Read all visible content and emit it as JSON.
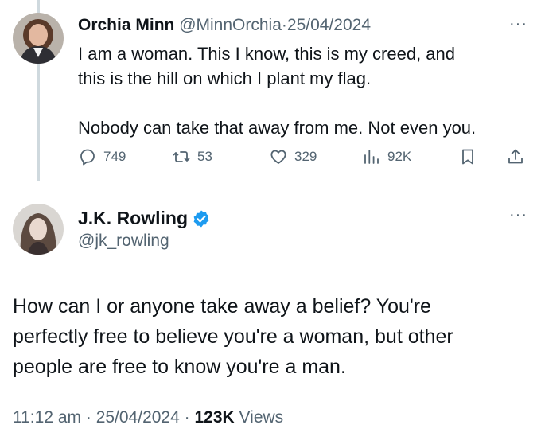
{
  "reply": {
    "author_name": "Orchia Minn",
    "handle": "@MinnOrchia",
    "separator": "·",
    "date": "25/04/2024",
    "more": "···",
    "text_lines": [
      "I am a woman.  This I know, this is my creed, and",
      "this is the hill on which I plant my flag.",
      "Nobody can take that away from me.  Not even you."
    ],
    "actions": {
      "replies": "749",
      "reposts": "53",
      "likes": "329",
      "views": "92K"
    }
  },
  "main": {
    "author_name": "J.K. Rowling",
    "handle": "@jk_rowling",
    "verified": true,
    "more": "···",
    "text_lines": [
      "How can I or anyone take away a belief? You're",
      "perfectly free to believe you're a woman, but other",
      "people are free to know you're a man."
    ],
    "time": "11:12 am",
    "separator": "·",
    "date": "25/04/2024",
    "views_count": "123K",
    "views_label": "Views"
  },
  "colors": {
    "text": "#0f1419",
    "secondary": "#536471",
    "verified": "#1d9bf0",
    "thread_line": "#cfd9de"
  },
  "icons": [
    "reply-icon",
    "repost-icon",
    "like-icon",
    "views-icon",
    "bookmark-icon",
    "share-icon",
    "verified-badge-icon",
    "more-icon"
  ]
}
